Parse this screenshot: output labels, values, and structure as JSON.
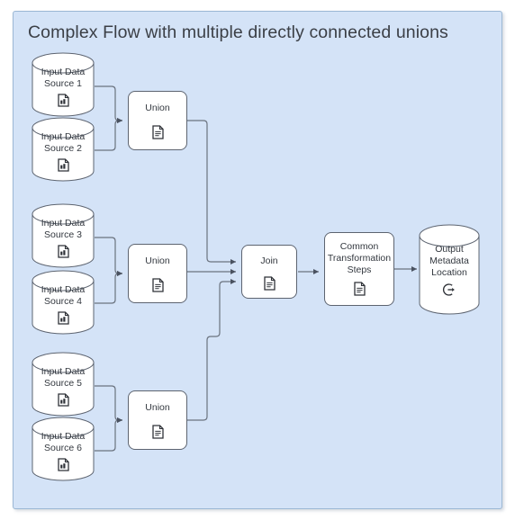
{
  "panel": {
    "title": "Complex Flow with multiple directly connected unions",
    "background_color": "#d4e3f7",
    "border_color": "#9bb7d4"
  },
  "theme": {
    "node_fill": "#ffffff",
    "node_stroke": "#5d6470",
    "edge_color": "#6b737f",
    "text_color": "#33383f"
  },
  "sources": [
    {
      "id": "src1",
      "label_line1": "Input Data",
      "label_line2": "Source 1",
      "icon": "data-file-icon"
    },
    {
      "id": "src2",
      "label_line1": "Input Data",
      "label_line2": "Source 2",
      "icon": "data-file-icon"
    },
    {
      "id": "src3",
      "label_line1": "Input Data",
      "label_line2": "Source 3",
      "icon": "data-file-icon"
    },
    {
      "id": "src4",
      "label_line1": "Input Data",
      "label_line2": "Source 4",
      "icon": "data-file-icon"
    },
    {
      "id": "src5",
      "label_line1": "Input Data",
      "label_line2": "Source 5",
      "icon": "data-file-icon"
    },
    {
      "id": "src6",
      "label_line1": "Input Data",
      "label_line2": "Source 6",
      "icon": "data-file-icon"
    }
  ],
  "unions": [
    {
      "id": "union1",
      "label": "Union",
      "icon": "document-icon"
    },
    {
      "id": "union2",
      "label": "Union",
      "icon": "document-icon"
    },
    {
      "id": "union3",
      "label": "Union",
      "icon": "document-icon"
    }
  ],
  "join": {
    "label": "Join",
    "icon": "document-icon"
  },
  "transform": {
    "label_line1": "Common",
    "label_line2": "Transformation",
    "label_line3": "Steps",
    "icon": "document-icon"
  },
  "output": {
    "label_line1": "Output",
    "label_line2": "Metadata",
    "label_line3": "Location",
    "icon": "export-circle-icon"
  },
  "chart_data": {
    "type": "diagram",
    "title": "Complex Flow with multiple directly connected unions",
    "nodes": [
      {
        "id": "src1",
        "type": "datastore",
        "label": "Input Data Source 1"
      },
      {
        "id": "src2",
        "type": "datastore",
        "label": "Input Data Source 2"
      },
      {
        "id": "src3",
        "type": "datastore",
        "label": "Input Data Source 3"
      },
      {
        "id": "src4",
        "type": "datastore",
        "label": "Input Data Source 4"
      },
      {
        "id": "src5",
        "type": "datastore",
        "label": "Input Data Source 5"
      },
      {
        "id": "src6",
        "type": "datastore",
        "label": "Input Data Source 6"
      },
      {
        "id": "union1",
        "type": "process",
        "label": "Union"
      },
      {
        "id": "union2",
        "type": "process",
        "label": "Union"
      },
      {
        "id": "union3",
        "type": "process",
        "label": "Union"
      },
      {
        "id": "join",
        "type": "process",
        "label": "Join"
      },
      {
        "id": "transform",
        "type": "process",
        "label": "Common Transformation Steps"
      },
      {
        "id": "output",
        "type": "datastore",
        "label": "Output Metadata Location"
      }
    ],
    "edges": [
      {
        "from": "src1",
        "to": "union1"
      },
      {
        "from": "src2",
        "to": "union1"
      },
      {
        "from": "src3",
        "to": "union2"
      },
      {
        "from": "src4",
        "to": "union2"
      },
      {
        "from": "src5",
        "to": "union3"
      },
      {
        "from": "src6",
        "to": "union3"
      },
      {
        "from": "union1",
        "to": "join"
      },
      {
        "from": "union2",
        "to": "join"
      },
      {
        "from": "union3",
        "to": "join"
      },
      {
        "from": "join",
        "to": "transform"
      },
      {
        "from": "transform",
        "to": "output"
      }
    ]
  }
}
